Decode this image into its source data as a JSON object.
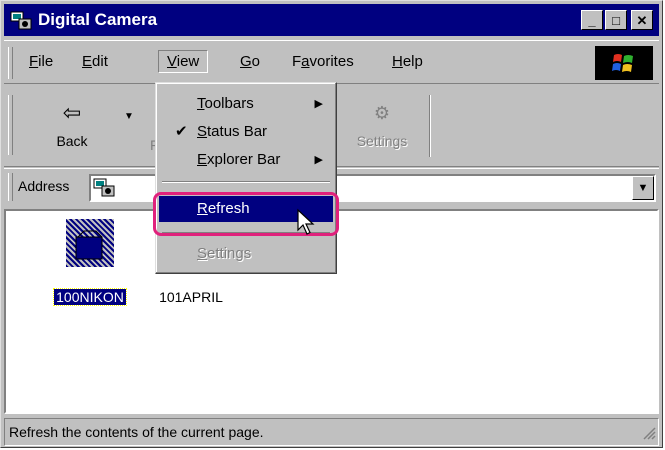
{
  "window": {
    "title": "Digital Camera"
  },
  "title_buttons": {
    "minimize": "_",
    "maximize": "□",
    "close": "✕"
  },
  "menubar": {
    "items": [
      {
        "label": "File",
        "accel": "F",
        "rest": "ile"
      },
      {
        "label": "Edit",
        "accel": "E",
        "rest": "dit"
      },
      {
        "label": "View",
        "accel": "V",
        "rest": "iew"
      },
      {
        "label": "Go",
        "accel": "G",
        "rest": "o"
      },
      {
        "label": "Favorites",
        "pre": "F",
        "accel": "a",
        "rest": "vorites"
      },
      {
        "label": "Help",
        "accel": "H",
        "rest": "elp"
      }
    ]
  },
  "toolbar": {
    "back_label": "Back",
    "forward_partial": "F",
    "settings_label": "Settings"
  },
  "address": {
    "label": "Address",
    "value": ""
  },
  "view_menu": {
    "items": [
      {
        "label": "Toolbars",
        "accel": "T",
        "rest": "oolbars",
        "submenu": true,
        "checked": false,
        "enabled": true
      },
      {
        "label": "Status Bar",
        "accel": "S",
        "rest": "tatus Bar",
        "submenu": false,
        "checked": true,
        "enabled": true
      },
      {
        "label": "Explorer Bar",
        "accel": "E",
        "rest": "xplorer Bar",
        "submenu": true,
        "checked": false,
        "enabled": true
      },
      {
        "label": "Refresh",
        "accel": "R",
        "rest": "efresh",
        "submenu": false,
        "checked": false,
        "enabled": true,
        "highlighted": true
      },
      {
        "label": "Settings",
        "accel": "S",
        "rest": "ettings",
        "submenu": false,
        "checked": false,
        "enabled": false
      }
    ]
  },
  "folders": [
    {
      "name": "100NIKON",
      "selected": true
    },
    {
      "name": "101APRIL",
      "selected": false
    }
  ],
  "status": {
    "text": "Refresh the contents of the current page."
  },
  "colors": {
    "titlebar": "#000080",
    "highlight": "#000080",
    "callout": "#e0217c",
    "face": "#c0c0c0"
  }
}
